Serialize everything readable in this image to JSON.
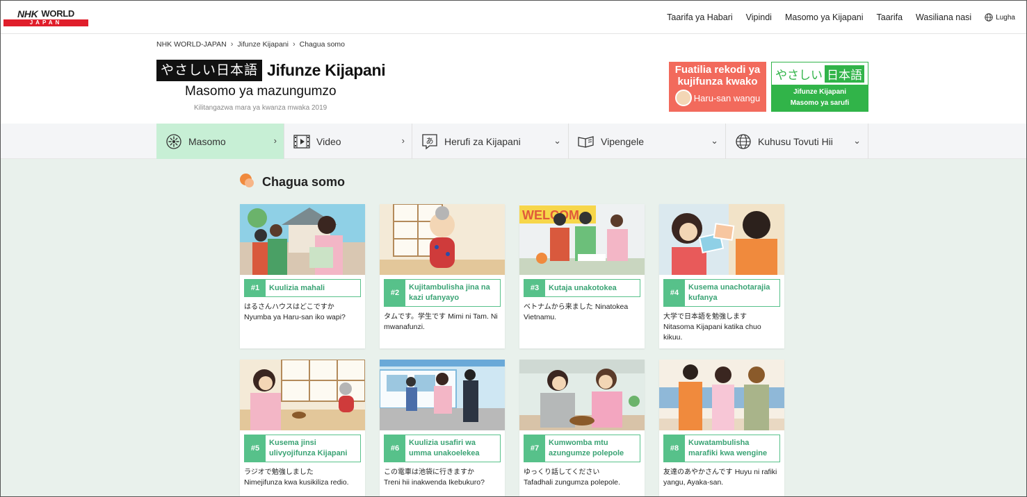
{
  "topnav": {
    "logo_top": "NHK",
    "logo_world": "WORLD",
    "logo_bottom": "JAPAN",
    "links": [
      "Taarifa ya Habari",
      "Vipindi",
      "Masomo ya Kijapani",
      "Taarifa",
      "Wasiliana nasi"
    ],
    "language": "Lugha"
  },
  "breadcrumb": [
    "NHK WORLD-JAPAN",
    "Jifunze Kijapani",
    "Chagua somo"
  ],
  "title": {
    "jp_box": "やさしい日本語",
    "main": "Jifunze Kijapani",
    "sub": "Masomo ya mazungumzo",
    "aired": "Kilitangazwa mara ya kwanza mwaka 2019"
  },
  "banners": {
    "red_line1": "Fuatilia rekodi ya",
    "red_line2": "kujifunza kwako",
    "red_line3": "Haru-san wangu",
    "green_jp_a": "やさしい",
    "green_jp_b": "日本語",
    "green_line1": "Jifunze Kijapani",
    "green_line2": "Masomo ya sarufi"
  },
  "secnav": [
    {
      "label": "Masomo",
      "icon": "flower-icon",
      "chevron": "›"
    },
    {
      "label": "Video",
      "icon": "film-icon",
      "chevron": "›"
    },
    {
      "label": "Herufi za Kijapani",
      "icon": "kana-icon",
      "chevron": "⌄"
    },
    {
      "label": "Vipengele",
      "icon": "book-icon",
      "chevron": "⌄"
    },
    {
      "label": "Kuhusu Tovuti Hii",
      "icon": "globe-icon",
      "chevron": "⌄"
    }
  ],
  "heading": "Chagua somo",
  "lessons": [
    {
      "num": "#1",
      "title": "Kuulizia mahali",
      "jp": "はるさんハウスはどこですか",
      "sw": "Nyumba ya Haru-san iko wapi?"
    },
    {
      "num": "#2",
      "title": "Kujitambulisha jina na kazi ufanyayo",
      "jp": "タムです。学生です",
      "sw": "Mimi ni Tam. Ni mwanafunzi."
    },
    {
      "num": "#3",
      "title": "Kutaja unakotokea",
      "jp": "ベトナムから来ました",
      "sw": "Ninatokea Vietnamu."
    },
    {
      "num": "#4",
      "title": "Kusema unachotarajia kufanya",
      "jp": "大学で日本語を勉強します",
      "sw": "Nitasoma Kijapani katika chuo kikuu."
    },
    {
      "num": "#5",
      "title": "Kusema jinsi ulivyojifunza Kijapani",
      "jp": "ラジオで勉強しました",
      "sw": "Nimejifunza kwa kusikiliza redio."
    },
    {
      "num": "#6",
      "title": "Kuulizia usafiri wa umma unakoelekea",
      "jp": "この電車は池袋に行きますか",
      "sw": "Treni hii inakwenda Ikebukuro?"
    },
    {
      "num": "#7",
      "title": "Kumwomba mtu azungumze polepole",
      "jp": "ゆっくり話してください",
      "sw": "Tafadhali zungumza polepole."
    },
    {
      "num": "#8",
      "title": "Kuwatambulisha marafiki kwa wengine",
      "jp": "友達のあやかさんです",
      "sw": "Huyu ni rafiki yangu, Ayaka-san."
    }
  ],
  "colors": {
    "accent_green": "#57c18a",
    "nav_active": "#c7efd5",
    "content_bg": "#e9f1ec",
    "nhk_red": "#e01e2b",
    "banner_red": "#f26a5c",
    "banner_green": "#31b449"
  }
}
